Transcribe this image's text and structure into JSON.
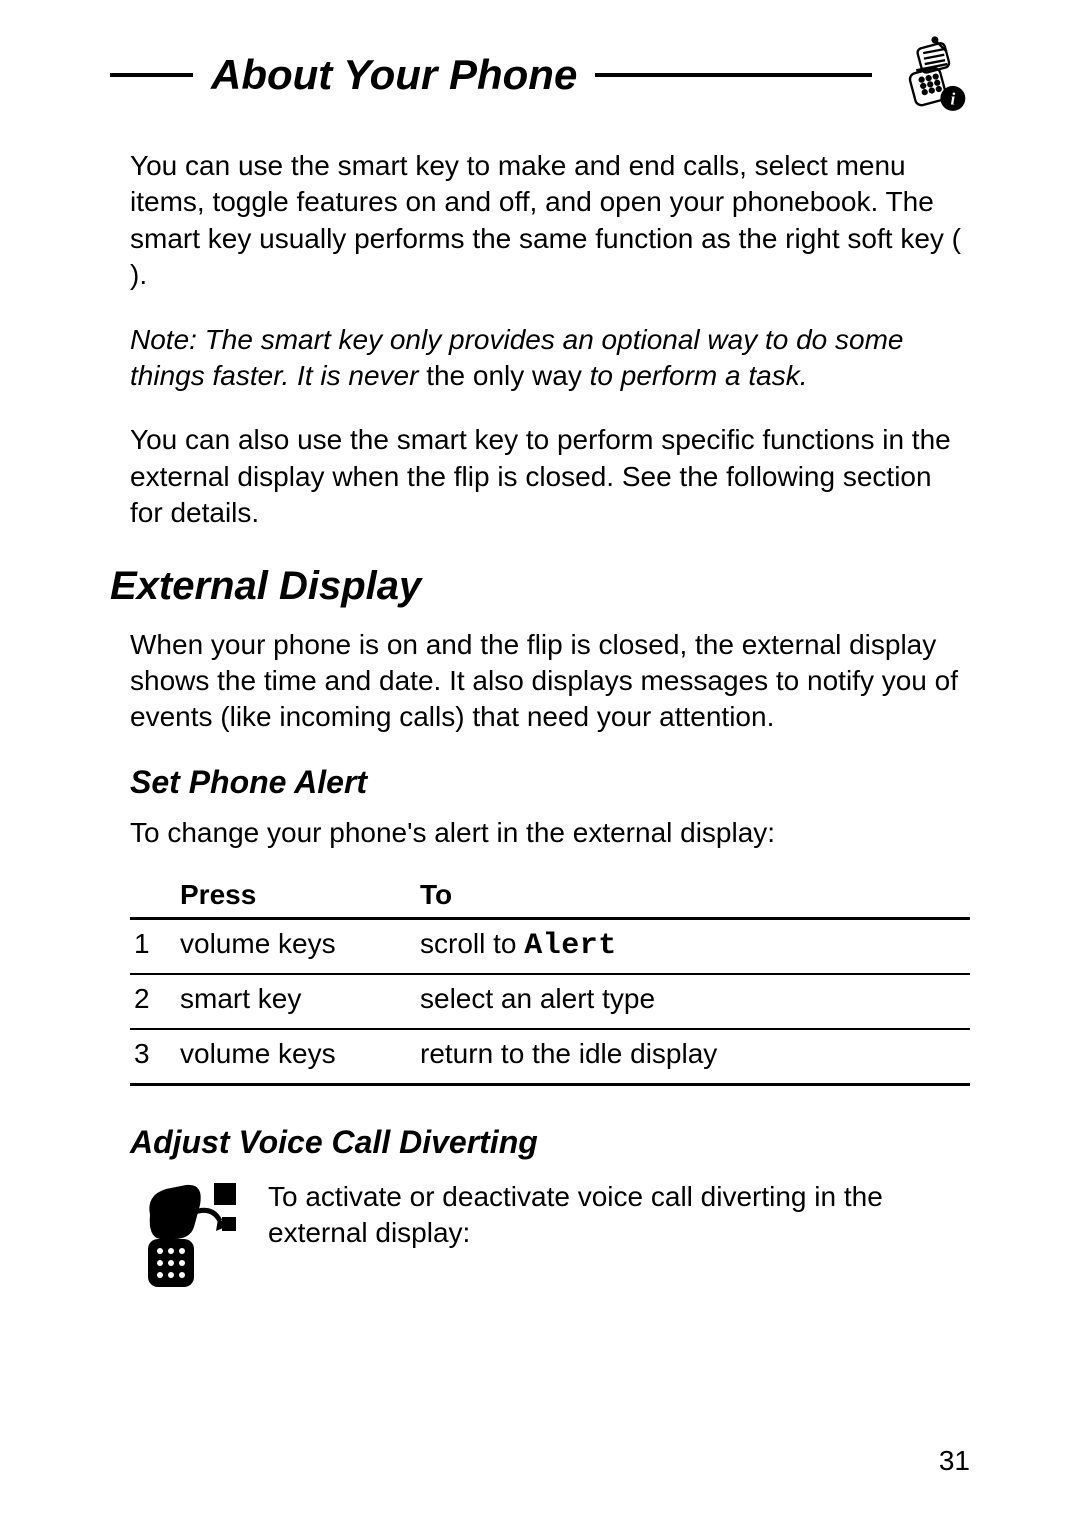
{
  "header": {
    "title": "About Your Phone"
  },
  "paras": {
    "intro": "You can use the smart key to make and end calls, select menu items, toggle features on and off, and open your phonebook. The smart key usually performs the same function as the right soft key (        ).",
    "note_lead": "Note: The smart key only provides an optional way to do some things faster. It is never ",
    "note_mid": "the only way",
    "note_tail": " to perform a task.",
    "intro2": "You can also use the smart key to perform specific functions in the external display when the flip is closed. See the following section for details.",
    "ext_heading": "External Display",
    "ext_body": "When your phone is on and the flip is closed, the external display shows the time and date. It also displays messages to notify you of events (like incoming calls) that need your attention.",
    "set_alert_heading": "Set Phone Alert",
    "set_alert_body": "To change your phone's alert in the external display:",
    "divert_heading": "Adjust Voice Call Diverting",
    "divert_body": "To activate or deactivate voice call diverting in the external display:"
  },
  "table": {
    "headers": {
      "press": "Press",
      "to": "To"
    },
    "rows": [
      {
        "num": "1",
        "press": "volume keys",
        "to_lead": "scroll to ",
        "to_mono": "Alert"
      },
      {
        "num": "2",
        "press": "smart key",
        "to_lead": "select an alert type",
        "to_mono": ""
      },
      {
        "num": "3",
        "press": "volume keys",
        "to_lead": "return to the idle display",
        "to_mono": ""
      }
    ]
  },
  "page_number": "31"
}
